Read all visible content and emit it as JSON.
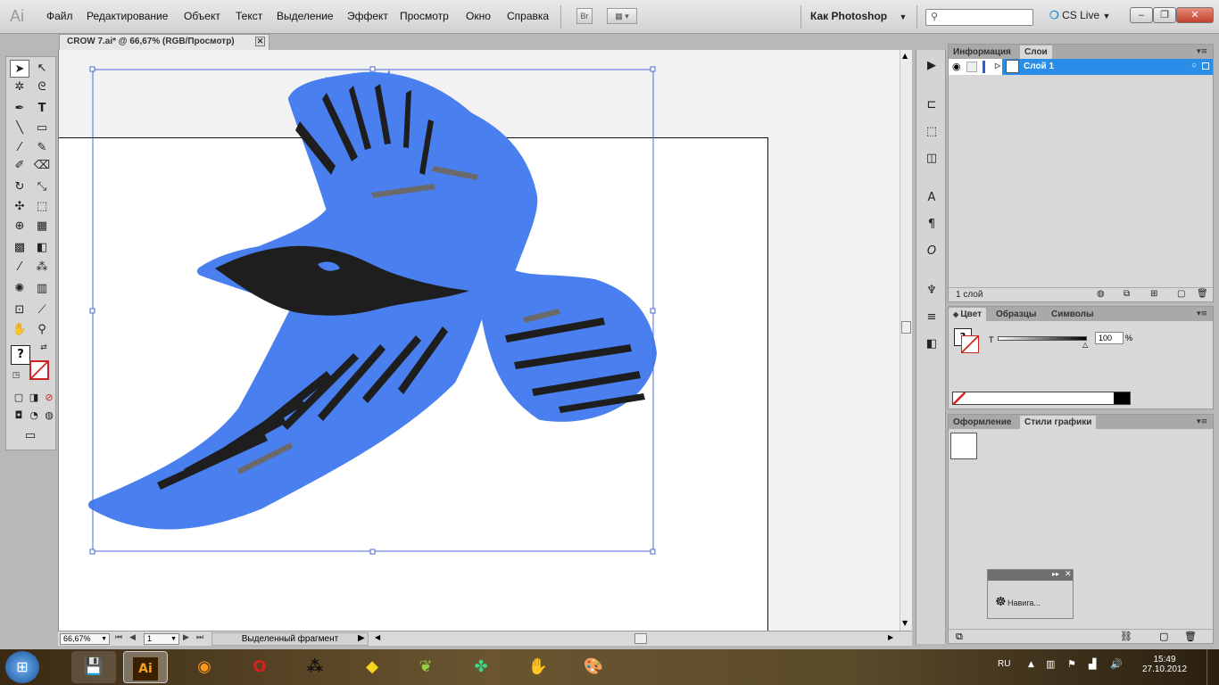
{
  "app": {
    "logo": "Ai"
  },
  "menu": [
    "Файл",
    "Редактирование",
    "Объект",
    "Текст",
    "Выделение",
    "Эффект",
    "Просмотр",
    "Окно",
    "Справка"
  ],
  "bridge_label": "Br",
  "workspace": "Как Photoshop",
  "cs_live": "CS Live",
  "window_controls": {
    "minimize": "–",
    "restore": "❐",
    "close": "✕"
  },
  "document_tab": {
    "title": "CROW 7.ai* @ 66,67% (RGB/Просмотр)",
    "close": "✕"
  },
  "statusbar": {
    "zoom": "66,67%",
    "page": "1",
    "info": "Выделенный фрагмент"
  },
  "layers_panel": {
    "tabs": [
      "Информация",
      "Слои"
    ],
    "active_tab": "Слои",
    "layer_name": "Слой 1",
    "layer_count": "1 слой"
  },
  "color_panel": {
    "tabs": [
      "Цвет",
      "Образцы",
      "Символы"
    ],
    "channel_label": "T",
    "value": "100",
    "unit": "%",
    "tint_percent": 100
  },
  "styles_panel": {
    "tabs": [
      "Оформление",
      "Стили графики"
    ]
  },
  "navigator_float": {
    "label": "Навига..."
  },
  "taskbar": {
    "lang": "RU",
    "time": "15:49",
    "date": "27.10.2012"
  },
  "colors": {
    "selection": "#2a8ee8",
    "bird_blue": "#4a7ff0",
    "bird_dark": "#1e1e1e",
    "bird_grey": "#6a6a6a"
  }
}
